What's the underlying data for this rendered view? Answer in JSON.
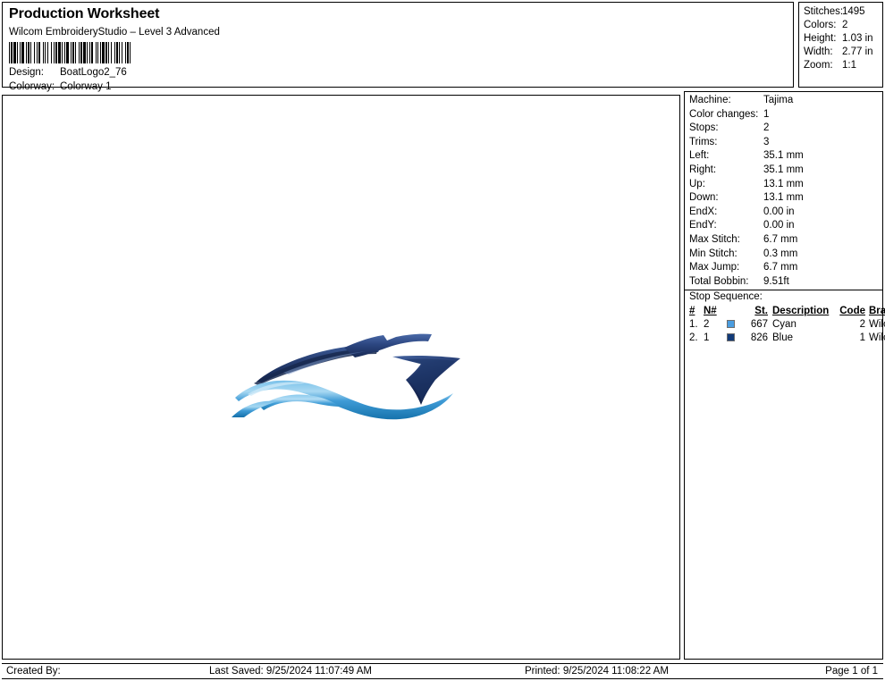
{
  "header": {
    "title": "Production Worksheet",
    "subtitle": "Wilcom EmbroideryStudio – Level 3 Advanced",
    "barcode_name": "barcode",
    "design_label": "Design:",
    "design_value": "BoatLogo2_76",
    "colorway_label": "Colorway:",
    "colorway_value": "Colorway 1"
  },
  "stats": [
    {
      "label": "Stitches:",
      "value": "1495"
    },
    {
      "label": "Colors:",
      "value": "2"
    },
    {
      "label": "Height:",
      "value": "1.03 in"
    },
    {
      "label": "Width:",
      "value": "2.77 in"
    },
    {
      "label": "Zoom:",
      "value": "1:1"
    }
  ],
  "info": [
    {
      "label": "Machine:",
      "value": "Tajima"
    },
    {
      "label": "Color changes:",
      "value": "1"
    },
    {
      "label": "Stops:",
      "value": "2"
    },
    {
      "label": "Trims:",
      "value": "3"
    },
    {
      "label": "Left:",
      "value": "35.1 mm"
    },
    {
      "label": "Right:",
      "value": "35.1 mm"
    },
    {
      "label": "Up:",
      "value": "13.1 mm"
    },
    {
      "label": "Down:",
      "value": "13.1 mm"
    },
    {
      "label": "EndX:",
      "value": "0.00 in"
    },
    {
      "label": "EndY:",
      "value": "0.00 in"
    },
    {
      "label": "Max Stitch:",
      "value": "6.7 mm"
    },
    {
      "label": "Min Stitch:",
      "value": "0.3 mm"
    },
    {
      "label": "Max Jump:",
      "value": "6.7 mm"
    },
    {
      "label": "Total Bobbin:",
      "value": "9.51ft"
    }
  ],
  "stop_sequence": {
    "section_label": "Stop Sequence:",
    "columns": [
      "#",
      "N#",
      "St.",
      "Description",
      "Code",
      "Brand"
    ],
    "rows": [
      {
        "num": "1.",
        "nnum": "2",
        "swatch": "#4a9de0",
        "st": "667",
        "desc": "Cyan",
        "code": "2",
        "brand": "Wilcom"
      },
      {
        "num": "2.",
        "nnum": "1",
        "swatch": "#123a78",
        "st": "826",
        "desc": "Blue",
        "code": "1",
        "brand": "Wilcom"
      }
    ]
  },
  "design": {
    "alt": "BoatLogo2_76 stylized speedboat embroidery design",
    "colors": {
      "hull_dark": "#1e3a6b",
      "hull_mid": "#2c4f8c",
      "hull_light": "#4a6aa5",
      "wave_dark": "#1b7bb8",
      "wave_mid": "#3a9ad9",
      "wave_light": "#8fc9ec"
    }
  },
  "footer": {
    "created_by": "Created By:",
    "last_saved": "Last Saved: 9/25/2024 11:07:49 AM",
    "printed": "Printed: 9/25/2024 11:08:22 AM",
    "page": "Page 1 of 1"
  }
}
